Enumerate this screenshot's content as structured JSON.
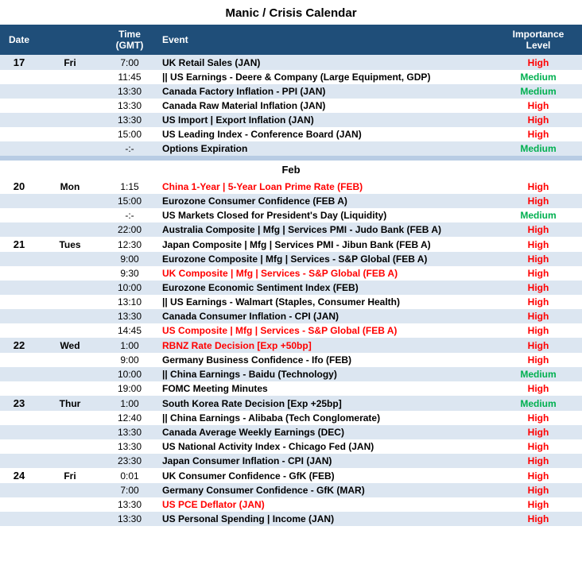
{
  "title": "Manic / Crisis Calendar",
  "headers": {
    "date": "Date",
    "time": "Time (GMT)",
    "event": "Event",
    "importance": "Importance Level"
  },
  "sections": [
    {
      "month": null,
      "rows": [
        {
          "date": "17",
          "day": "Fri",
          "time": "7:00",
          "event": "UK Retail Sales (JAN)",
          "event_style": "normal",
          "importance": "High",
          "imp_style": "high",
          "bg": "light"
        },
        {
          "date": "",
          "day": "",
          "time": "11:45",
          "event": "|| US Earnings - Deere & Company (Large Equipment, GDP)",
          "event_style": "normal",
          "importance": "Medium",
          "imp_style": "medium",
          "bg": "white"
        },
        {
          "date": "",
          "day": "",
          "time": "13:30",
          "event": "Canada Factory Inflation - PPI (JAN)",
          "event_style": "normal",
          "importance": "Medium",
          "imp_style": "medium",
          "bg": "light"
        },
        {
          "date": "",
          "day": "",
          "time": "13:30",
          "event": "Canada Raw Material Inflation (JAN)",
          "event_style": "normal",
          "importance": "High",
          "imp_style": "high",
          "bg": "white"
        },
        {
          "date": "",
          "day": "",
          "time": "13:30",
          "event": "US Import | Export Inflation (JAN)",
          "event_style": "normal",
          "importance": "High",
          "imp_style": "high",
          "bg": "light"
        },
        {
          "date": "",
          "day": "",
          "time": "15:00",
          "event": "US Leading Index - Conference Board (JAN)",
          "event_style": "normal",
          "importance": "High",
          "imp_style": "high",
          "bg": "white"
        },
        {
          "date": "",
          "day": "",
          "time": "-:-",
          "event": "Options Expiration",
          "event_style": "normal",
          "importance": "Medium",
          "imp_style": "medium",
          "bg": "light"
        }
      ]
    },
    {
      "month": "Feb",
      "rows": [
        {
          "date": "20",
          "day": "Mon",
          "time": "1:15",
          "event": "China 1-Year | 5-Year Loan Prime Rate (FEB)",
          "event_style": "red",
          "importance": "High",
          "imp_style": "high",
          "bg": "white"
        },
        {
          "date": "",
          "day": "",
          "time": "15:00",
          "event": "Eurozone Consumer Confidence (FEB A)",
          "event_style": "normal",
          "importance": "High",
          "imp_style": "high",
          "bg": "light"
        },
        {
          "date": "",
          "day": "",
          "time": "-:-",
          "event": "US Markets Closed for President's Day (Liquidity)",
          "event_style": "normal",
          "importance": "Medium",
          "imp_style": "medium",
          "bg": "white"
        },
        {
          "date": "",
          "day": "",
          "time": "22:00",
          "event": "Australia Composite | Mfg | Services PMI - Judo Bank (FEB A)",
          "event_style": "normal",
          "importance": "High",
          "imp_style": "high",
          "bg": "light"
        },
        {
          "date": "21",
          "day": "Tues",
          "time": "12:30",
          "event": "Japan Composite | Mfg | Services PMI - Jibun Bank (FEB A)",
          "event_style": "normal",
          "importance": "High",
          "imp_style": "high",
          "bg": "white"
        },
        {
          "date": "",
          "day": "",
          "time": "9:00",
          "event": "Eurozone Composite | Mfg | Services - S&P Global (FEB A)",
          "event_style": "normal",
          "importance": "High",
          "imp_style": "high",
          "bg": "light"
        },
        {
          "date": "",
          "day": "",
          "time": "9:30",
          "event": "UK Composite | Mfg | Services - S&P Global (FEB A)",
          "event_style": "red",
          "importance": "High",
          "imp_style": "high",
          "bg": "white"
        },
        {
          "date": "",
          "day": "",
          "time": "10:00",
          "event": "Eurozone Economic Sentiment Index (FEB)",
          "event_style": "normal",
          "importance": "High",
          "imp_style": "high",
          "bg": "light"
        },
        {
          "date": "",
          "day": "",
          "time": "13:10",
          "event": "|| US Earnings - Walmart (Staples, Consumer Health)",
          "event_style": "normal",
          "importance": "High",
          "imp_style": "high",
          "bg": "white"
        },
        {
          "date": "",
          "day": "",
          "time": "13:30",
          "event": "Canada Consumer Inflation - CPI (JAN)",
          "event_style": "normal",
          "importance": "High",
          "imp_style": "high",
          "bg": "light"
        },
        {
          "date": "",
          "day": "",
          "time": "14:45",
          "event": "US Composite | Mfg | Services - S&P Global (FEB A)",
          "event_style": "red",
          "importance": "High",
          "imp_style": "high",
          "bg": "white"
        },
        {
          "date": "22",
          "day": "Wed",
          "time": "1:00",
          "event": "RBNZ Rate Decision [Exp +50bp]",
          "event_style": "red",
          "importance": "High",
          "imp_style": "high",
          "bg": "light"
        },
        {
          "date": "",
          "day": "",
          "time": "9:00",
          "event": "Germany Business Confidence - Ifo (FEB)",
          "event_style": "normal",
          "importance": "High",
          "imp_style": "high",
          "bg": "white"
        },
        {
          "date": "",
          "day": "",
          "time": "10:00",
          "event": "|| China Earnings - Baidu (Technology)",
          "event_style": "normal",
          "importance": "Medium",
          "imp_style": "medium",
          "bg": "light"
        },
        {
          "date": "",
          "day": "",
          "time": "19:00",
          "event": "FOMC Meeting Minutes",
          "event_style": "normal",
          "importance": "High",
          "imp_style": "high",
          "bg": "white"
        },
        {
          "date": "23",
          "day": "Thur",
          "time": "1:00",
          "event": "South Korea Rate Decision [Exp +25bp]",
          "event_style": "normal",
          "importance": "Medium",
          "imp_style": "medium",
          "bg": "light"
        },
        {
          "date": "",
          "day": "",
          "time": "12:40",
          "event": "|| China Earnings - Alibaba (Tech Conglomerate)",
          "event_style": "normal",
          "importance": "High",
          "imp_style": "high",
          "bg": "white"
        },
        {
          "date": "",
          "day": "",
          "time": "13:30",
          "event": "Canada Average Weekly Earnings (DEC)",
          "event_style": "normal",
          "importance": "High",
          "imp_style": "high",
          "bg": "light"
        },
        {
          "date": "",
          "day": "",
          "time": "13:30",
          "event": "US National Activity Index - Chicago Fed (JAN)",
          "event_style": "normal",
          "importance": "High",
          "imp_style": "high",
          "bg": "white"
        },
        {
          "date": "",
          "day": "",
          "time": "23:30",
          "event": "Japan Consumer Inflation - CPI (JAN)",
          "event_style": "normal",
          "importance": "High",
          "imp_style": "high",
          "bg": "light"
        },
        {
          "date": "24",
          "day": "Fri",
          "time": "0:01",
          "event": "UK Consumer Confidence - GfK (FEB)",
          "event_style": "normal",
          "importance": "High",
          "imp_style": "high",
          "bg": "white"
        },
        {
          "date": "",
          "day": "",
          "time": "7:00",
          "event": "Germany Consumer Confidence - GfK (MAR)",
          "event_style": "normal",
          "importance": "High",
          "imp_style": "high",
          "bg": "light"
        },
        {
          "date": "",
          "day": "",
          "time": "13:30",
          "event": "US PCE Deflator (JAN)",
          "event_style": "red",
          "importance": "High",
          "imp_style": "high",
          "bg": "white"
        },
        {
          "date": "",
          "day": "",
          "time": "13:30",
          "event": "US Personal Spending | Income (JAN)",
          "event_style": "normal",
          "importance": "High",
          "imp_style": "high",
          "bg": "light"
        }
      ]
    }
  ]
}
